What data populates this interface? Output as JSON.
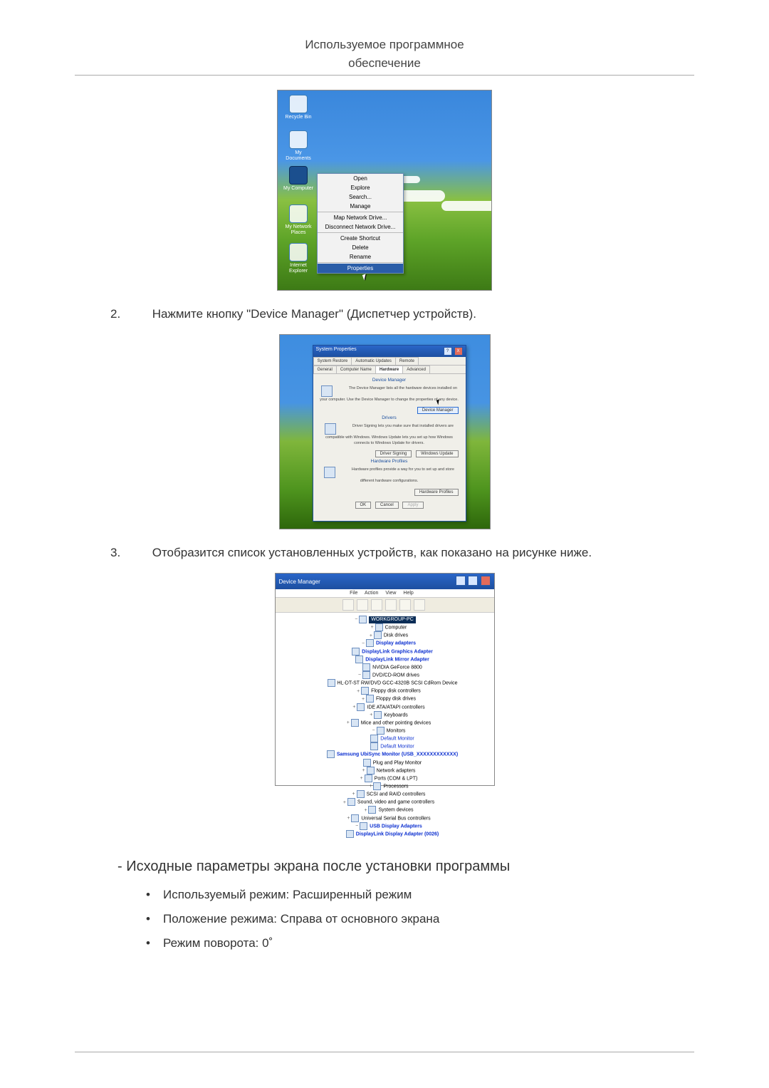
{
  "header": {
    "title_line1": "Используемое программное",
    "title_line2": "обеспечение"
  },
  "steps": {
    "s2_num": "2.",
    "s2_text": "Нажмите кнопку \"Device Manager\" (Диспетчер устройств).",
    "s3_num": "3.",
    "s3_text": "Отобразится список установленных устройств, как показано на рисунке ниже."
  },
  "fig1": {
    "icons": {
      "recycle": "Recycle Bin",
      "mydocs": "My Documents",
      "mycomputer": "My Computer",
      "netplaces": "My Network Places",
      "ie": "Internet Explorer"
    },
    "menu": {
      "open": "Open",
      "explore": "Explore",
      "search": "Search...",
      "manage": "Manage",
      "mapdrive": "Map Network Drive...",
      "disconnect": "Disconnect Network Drive...",
      "shortcut": "Create Shortcut",
      "delete": "Delete",
      "rename": "Rename",
      "properties": "Properties"
    }
  },
  "fig2": {
    "title": "System Properties",
    "help": "?",
    "close": "X",
    "tabs": {
      "sysrestore": "System Restore",
      "autoupdate": "Automatic Updates",
      "remote": "Remote",
      "general": "General",
      "compname": "Computer Name",
      "hardware": "Hardware",
      "advanced": "Advanced"
    },
    "dm_title": "Device Manager",
    "dm_desc": "The Device Manager lists all the hardware devices installed on your computer. Use the Device Manager to change the properties of any device.",
    "dm_btn": "Device Manager",
    "drv_title": "Drivers",
    "drv_desc": "Driver Signing lets you make sure that installed drivers are compatible with Windows. Windows Update lets you set up how Windows connects to Windows Update for drivers.",
    "drv_btn1": "Driver Signing",
    "drv_btn2": "Windows Update",
    "hw_title": "Hardware Profiles",
    "hw_desc": "Hardware profiles provide a way for you to set up and store different hardware configurations.",
    "hw_btn": "Hardware Profiles",
    "ok": "OK",
    "cancel": "Cancel",
    "apply": "Apply"
  },
  "fig3": {
    "title": "Device Manager",
    "menus": {
      "file": "File",
      "action": "Action",
      "view": "View",
      "help": "Help"
    },
    "tree": {
      "root": "WORKGROUP-PC",
      "computer": "Computer",
      "disk": "Disk drives",
      "display": "Display adapters",
      "display_c1": "DisplayLink Graphics Adapter",
      "display_c2": "DisplayLink Mirror Adapter",
      "display_c3": "NVIDIA GeForce 8800",
      "dvd": "DVD/CD-ROM drives",
      "dvd_c1": "HL-DT-ST RW/DVD GCC-4320B SCSI CdRom Device",
      "floppyctrl": "Floppy disk controllers",
      "floppy": "Floppy disk drives",
      "ide": "IDE ATA/ATAPI controllers",
      "keyboard": "Keyboards",
      "mice": "Mice and other pointing devices",
      "monitors": "Monitors",
      "mon_c1": "Default Monitor",
      "mon_c2": "Default Monitor",
      "mon_c3": "Samsung UbiSync Monitor (USB_XXXXXXXXXXXX)",
      "mon_c4": "Plug and Play Monitor",
      "network": "Network adapters",
      "ports": "Ports (COM & LPT)",
      "processors": "Processors",
      "scsi": "SCSI and RAID controllers",
      "sound": "Sound, video and game controllers",
      "system": "System devices",
      "usb": "Universal Serial Bus controllers",
      "usbdisp": "USB Display Adapters",
      "usbdisp_c1": "DisplayLink Display Adapter (0026)"
    }
  },
  "section": {
    "heading": "- Исходные параметры экрана после установки программы",
    "b1": "Используемый режим: Расширенный режим",
    "b2": "Положение режима: Справа от основного экрана",
    "b3": "Режим поворота: 0˚"
  }
}
